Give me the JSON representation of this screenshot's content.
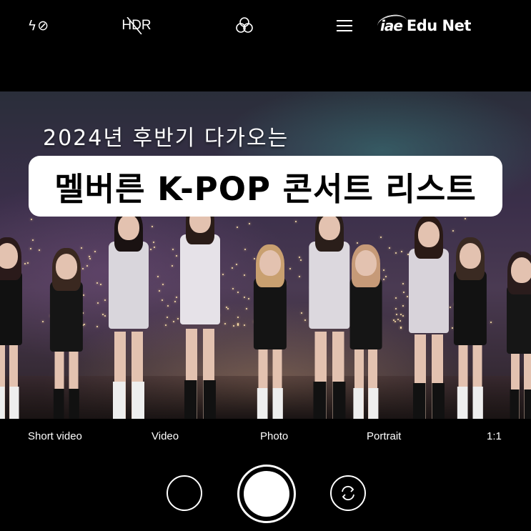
{
  "topbar": {
    "flash_label": "ϟ⊘",
    "hdr_label": "HDR",
    "filters_icon": "filters-icon",
    "menu_icon": "menu-icon",
    "brand_logo": "iae",
    "brand_name": "Edu Net"
  },
  "viewfinder": {
    "subtitle": "2024년 후반기 다가오는",
    "title": "멜버른 K-POP 콘서트 리스트"
  },
  "modes": {
    "short_video": "Short video",
    "video": "Video",
    "photo": "Photo",
    "portrait": "Portrait",
    "ratio": "1:1"
  },
  "controls": {
    "gallery_icon": "gallery-thumbnail",
    "shutter_icon": "shutter-button",
    "switch_icon": "camera-switch-icon"
  }
}
